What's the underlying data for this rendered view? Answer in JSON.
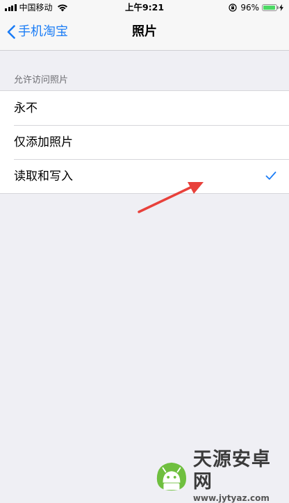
{
  "status_bar": {
    "carrier": "中国移动",
    "time": "上午9:21",
    "battery_percent": "96%",
    "battery_level": 0.96,
    "battery_color": "#4cd964"
  },
  "nav": {
    "back_label": "手机淘宝",
    "title": "照片",
    "accent_color": "#1a7cf6"
  },
  "section": {
    "header": "允许访问照片",
    "options": [
      {
        "label": "永不",
        "selected": false
      },
      {
        "label": "仅添加照片",
        "selected": false
      },
      {
        "label": "读取和写入",
        "selected": true
      }
    ]
  },
  "annotation": {
    "arrow_color": "#e8413b"
  },
  "watermark": {
    "title": "天源安卓网",
    "url": "www.jytyaz.com"
  }
}
